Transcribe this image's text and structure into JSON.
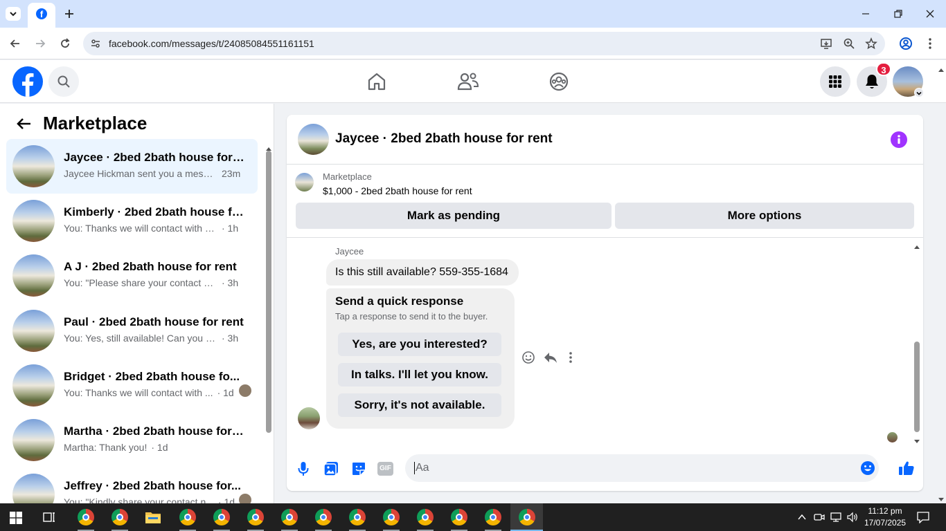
{
  "browser": {
    "url": "facebook.com/messages/t/24085084551161151"
  },
  "header": {
    "notification_count": "3"
  },
  "left_panel": {
    "title": "Marketplace",
    "conversations": [
      {
        "name": "Jaycee · 2bed 2bath house for rent",
        "snippet": "Jaycee Hickman sent you a messa...",
        "time": "23m",
        "active": true
      },
      {
        "name": "Kimberly · 2bed 2bath house for...",
        "snippet": "You: Thanks we will contact with yo...",
        "time": "· 1h"
      },
      {
        "name": "A J · 2bed 2bath house for rent",
        "snippet": "You: \"Please share your contact nu...",
        "time": "· 3h"
      },
      {
        "name": "Paul · 2bed 2bath house for rent",
        "snippet": "You: Yes, still available! Can you sha...",
        "time": "· 3h"
      },
      {
        "name": "Bridget · 2bed 2bath house fo...",
        "snippet": "You: Thanks we will contact with ...",
        "time": "· 1d"
      },
      {
        "name": "Martha · 2bed 2bath house for r...",
        "snippet": "Martha: Thank you!",
        "time": "· 1d"
      },
      {
        "name": "Jeffrey · 2bed 2bath house for...",
        "snippet": "You: \"Kindly share your contact n...",
        "time": "· 1d"
      }
    ]
  },
  "chat": {
    "title": "Jaycee · 2bed 2bath house for rent",
    "listing": {
      "label": "Marketplace",
      "price_title": "$1,000 - 2bed 2bath house for rent",
      "mark_pending": "Mark as pending",
      "more_options": "More options"
    },
    "sender_name": "Jaycee",
    "message": "Is this still available? 559-355-1684",
    "quick_response": {
      "title": "Send a quick response",
      "subtitle": "Tap a response to send it to the buyer.",
      "options": [
        "Yes, are you interested?",
        "In talks. I'll let you know.",
        "Sorry, it's not available."
      ]
    },
    "composer_placeholder": "Aa",
    "gif_label": "GIF"
  },
  "taskbar": {
    "time": "11:12 pm",
    "date": "17/07/2025"
  },
  "colors": {
    "fb_blue": "#0866ff",
    "badge_red": "#e41e3f",
    "info_purple": "#a033ff",
    "active_bg": "#ebf5ff"
  }
}
